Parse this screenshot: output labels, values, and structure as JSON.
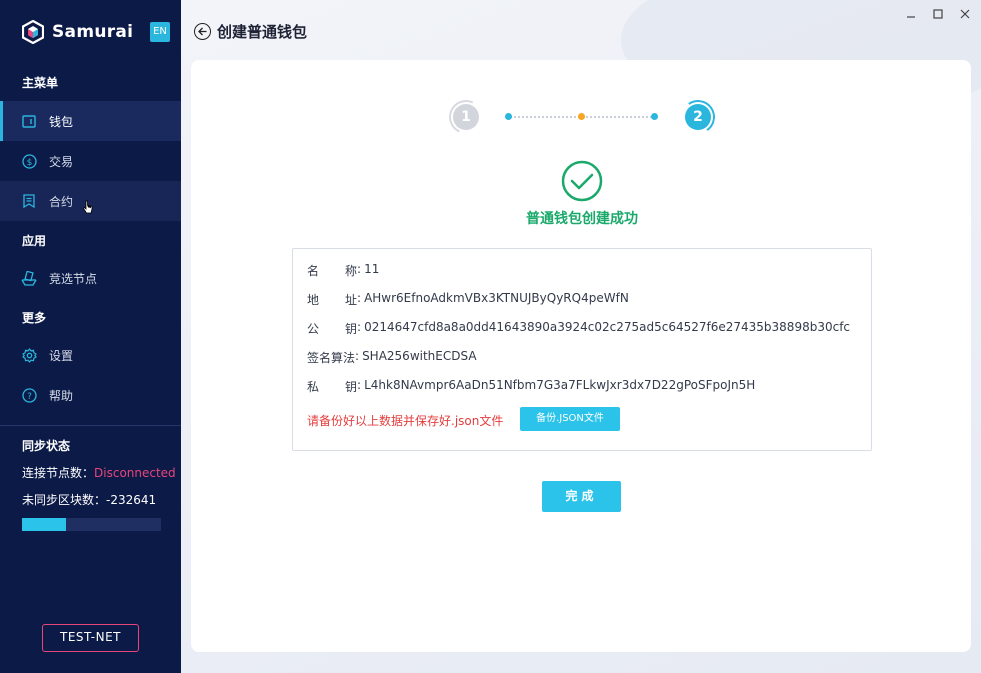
{
  "app": {
    "brand": "Samurai",
    "lang_badge": "EN"
  },
  "sidebar": {
    "section_main": "主菜单",
    "section_apps": "应用",
    "section_more": "更多",
    "items": [
      {
        "label": "钱包",
        "icon": "wallet-icon",
        "active": true
      },
      {
        "label": "交易",
        "icon": "dollar-circle-icon"
      },
      {
        "label": "合约",
        "icon": "contract-icon"
      },
      {
        "label": "竞选节点",
        "icon": "vote-node-icon"
      },
      {
        "label": "设置",
        "icon": "gear-icon"
      },
      {
        "label": "帮助",
        "icon": "help-icon"
      }
    ],
    "sync": {
      "title": "同步状态",
      "nodes_label": "连接节点数：",
      "nodes_value": "Disconnected",
      "blocks_label": "未同步区块数：",
      "blocks_value": "-232641",
      "progress_fraction": 0.32
    },
    "network": "TEST-NET"
  },
  "header": {
    "title": "创建普通钱包"
  },
  "steps": {
    "step1": "1",
    "step2": "2"
  },
  "result": {
    "success_text": "普通钱包创建成功",
    "rows": [
      {
        "label_a": "名",
        "label_b": "称",
        "value": "11"
      },
      {
        "label_a": "地",
        "label_b": "址",
        "value": "AHwr6EfnoAdkmVBx3KTNUJByQyRQ4peWfN"
      },
      {
        "label_a": "公",
        "label_b": "钥",
        "value": "0214647cfd8a8a0dd41643890a3924c02c275ad5c64527f6e27435b38898b30cfc"
      },
      {
        "label_a": "签名算法",
        "label_b": "",
        "value": "SHA256withECDSA"
      },
      {
        "label_a": "私",
        "label_b": "钥",
        "value": "L4hk8NAvmpr6AaDn51Nfbm7G3a7FLkwJxr3dx7D22gPoSFpoJn5H"
      }
    ],
    "warning": "请备份好以上数据并保存好.json文件",
    "backup_button": "备份.JSON文件"
  },
  "finish_button": "完成",
  "colors": {
    "sidebar_bg": "#0c1a47",
    "accent": "#2bb6de",
    "success": "#1aa96b",
    "danger": "#e53d3d",
    "status_pink": "#e8457a"
  }
}
